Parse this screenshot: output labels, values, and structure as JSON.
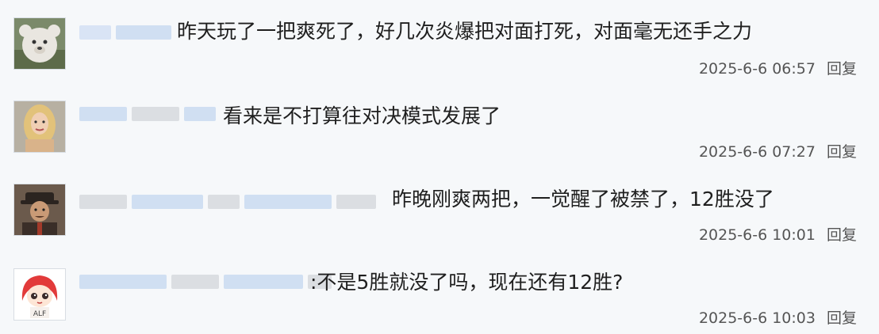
{
  "comments": [
    {
      "text": "昨天玩了一把爽死了，好几次炎爆把对面打死，对面毫无还手之力",
      "time": "2025-6-6 06:57",
      "reply_label": "回复",
      "avatar_icon": "plush-bear-avatar-icon"
    },
    {
      "text": "看来是不打算往对决模式发展了",
      "time": "2025-6-6 07:27",
      "reply_label": "回复",
      "avatar_icon": "blonde-woman-avatar-icon"
    },
    {
      "text": "昨晚刚爽两把，一觉醒了被禁了，12胜没了",
      "time": "2025-6-6 10:01",
      "reply_label": "回复",
      "avatar_icon": "man-in-hat-avatar-icon"
    },
    {
      "text": ":不是5胜就没了吗，现在还有12胜?",
      "time": "2025-6-6 10:03",
      "reply_label": "回复",
      "avatar_icon": "red-haired-anime-girl-avatar-icon"
    }
  ],
  "colors": {
    "background": "#f6f8fa",
    "blur_blue": "#c9daf0",
    "blur_gray": "#d6d9dd"
  }
}
